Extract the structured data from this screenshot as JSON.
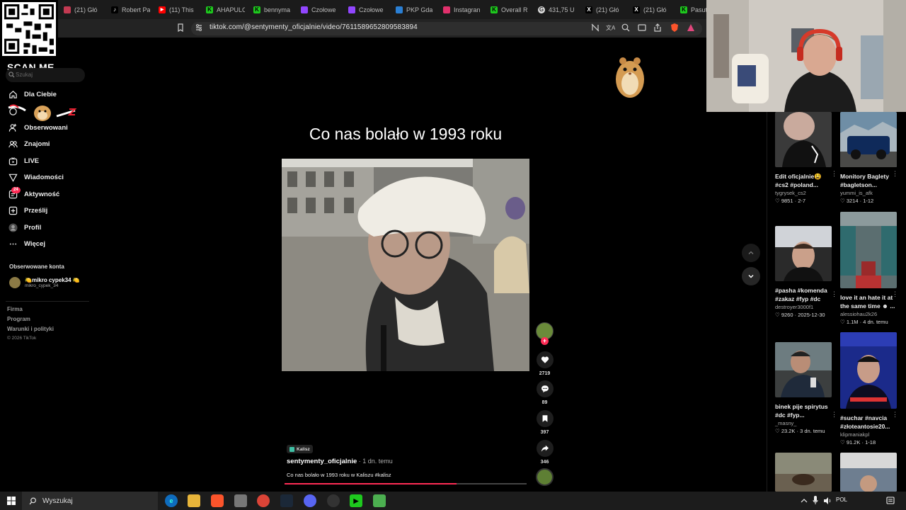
{
  "browser": {
    "tabs": [
      {
        "label": "(21) Głó",
        "color": "#c33a52",
        "glyph": ""
      },
      {
        "label": "Robert Pa",
        "color": "#000000",
        "glyph": "♪"
      },
      {
        "label": "(11) This",
        "color": "#ff0000",
        "glyph": "▶"
      },
      {
        "label": "AHAPULC",
        "color": "#1ec91e",
        "glyph": "K"
      },
      {
        "label": "bennyma",
        "color": "#1ec91e",
        "glyph": "K"
      },
      {
        "label": "Czołowe",
        "color": "#9146ff",
        "glyph": ""
      },
      {
        "label": "Czołowe",
        "color": "#9146ff",
        "glyph": ""
      },
      {
        "label": "PKP Gda",
        "color": "#2a7fd4",
        "glyph": ""
      },
      {
        "label": "Instagran",
        "color": "#e1306c",
        "glyph": ""
      },
      {
        "label": "Overall R",
        "color": "#1ec91e",
        "glyph": "K"
      },
      {
        "label": "431,75 U",
        "color": "#dddddd",
        "glyph": "G"
      },
      {
        "label": "(21) Głó",
        "color": "#000000",
        "glyph": "X"
      },
      {
        "label": "(21) Głó",
        "color": "#000000",
        "glyph": "X"
      },
      {
        "label": "Pasut - V",
        "color": "#1ec91e",
        "glyph": "K"
      }
    ],
    "url": "tiktok.com/@sentymenty_oficjalnie/video/7611589652809583894"
  },
  "overlay": {
    "qr_label": "SCAN ME"
  },
  "sidebar": {
    "search_placeholder": "Szukaj",
    "items": [
      {
        "label": "Dla Ciebie",
        "icon": "home-icon"
      },
      {
        "label": "",
        "icon": "explore-icon"
      },
      {
        "label": "Obserwowani",
        "icon": "following-icon"
      },
      {
        "label": "Znajomi",
        "icon": "friends-icon"
      },
      {
        "label": "LIVE",
        "icon": "live-icon"
      },
      {
        "label": "Wiadomości",
        "icon": "messages-icon"
      },
      {
        "label": "Aktywność",
        "icon": "activity-icon"
      },
      {
        "label": "Prześlij",
        "icon": "upload-icon"
      },
      {
        "label": "Profil",
        "icon": "profile-icon"
      },
      {
        "label": "Więcej",
        "icon": "more-icon"
      }
    ],
    "activity_badge": "24",
    "followed_section": "Obserwowane konta",
    "followed": [
      {
        "name": "🍋mikro cypek34 🍋",
        "handle": "mikro_cypek_34"
      }
    ],
    "footer_links": [
      "Firma",
      "Program",
      "Warunki i polityki"
    ],
    "copyright": "© 2026 TikTok"
  },
  "video": {
    "title": "Co nas bolało w 1993 roku",
    "author": "sentymenty_oficjalnie",
    "posted": " · 1 dn. temu",
    "caption": "Co nas bolało w 1993 roku w Kaliszu #kalisz",
    "location_tag": "Kalisz",
    "progress": 0.71,
    "likes": "2719",
    "comments": "89",
    "saves": "397",
    "shares": "346"
  },
  "feed": [
    {
      "title": "Edit oficjalnie😫 #cs2 #poland...",
      "author": "tygrysek_cs2",
      "likes": "9851",
      "date": "2-7"
    },
    {
      "title": "Monitory Baglety #bagletson...",
      "author": "yummi_is_afk",
      "likes": "3214",
      "date": "1-12"
    },
    {
      "title": "#pasha #komenda #zakaz #fyp #dc",
      "author": "destroyer3000f1",
      "likes": "9260",
      "date": "2025-12-30"
    },
    {
      "title": "love it an hate it at the same time ☻ ...",
      "author": "alessiohau2k26",
      "likes": "1.1M",
      "date": "4 dn. temu"
    },
    {
      "title": "binek pije spirytus #dc #fyp...",
      "author": "_masny_",
      "likes": "23.2K",
      "date": "3 dn. temu"
    },
    {
      "title": "#suchar #navcia #złoteantosie20...",
      "author": "klipmaniakpl",
      "likes": "91.2K",
      "date": "1-18"
    }
  ],
  "taskbar": {
    "search_label": "Wyszukaj",
    "lang": "POL"
  }
}
